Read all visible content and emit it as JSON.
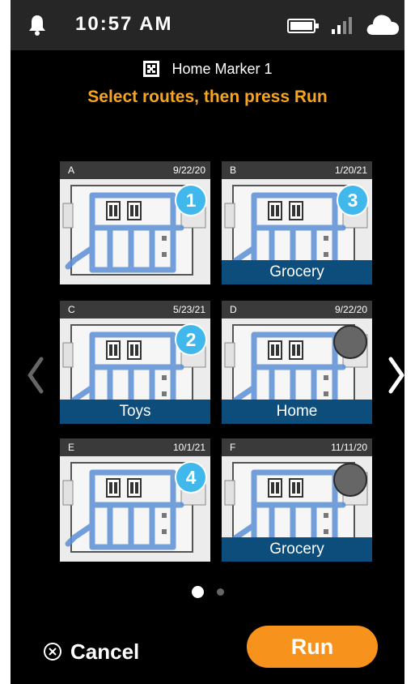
{
  "status_bar": {
    "time": "10:57 AM",
    "icons": [
      "bell-icon",
      "battery-icon",
      "signal-icon",
      "cloud-icon"
    ]
  },
  "header": {
    "marker_icon": "marker-icon",
    "marker_label": "Home Marker 1",
    "instruction": "Select routes, then press Run"
  },
  "routes": [
    {
      "letter": "A",
      "date": "9/22/20",
      "order": "1",
      "selected": true,
      "label": ""
    },
    {
      "letter": "B",
      "date": "1/20/21",
      "order": "3",
      "selected": true,
      "label": "Grocery"
    },
    {
      "letter": "C",
      "date": "5/23/21",
      "order": "2",
      "selected": true,
      "label": "Toys"
    },
    {
      "letter": "D",
      "date": "9/22/20",
      "order": "",
      "selected": false,
      "label": "Home"
    },
    {
      "letter": "E",
      "date": "10/1/21",
      "order": "4",
      "selected": true,
      "label": ""
    },
    {
      "letter": "F",
      "date": "11/11/20",
      "order": "",
      "selected": false,
      "label": "Grocery"
    }
  ],
  "pagination": {
    "current": 1,
    "total": 2
  },
  "footer": {
    "cancel_label": "Cancel",
    "run_label": "Run"
  },
  "colors": {
    "accent_orange": "#f7931d",
    "instruction_orange": "#f7a51c",
    "badge_blue": "#40b8ec",
    "label_bar_blue": "#0d4d7c",
    "route_blue": "#5b8fd6"
  }
}
